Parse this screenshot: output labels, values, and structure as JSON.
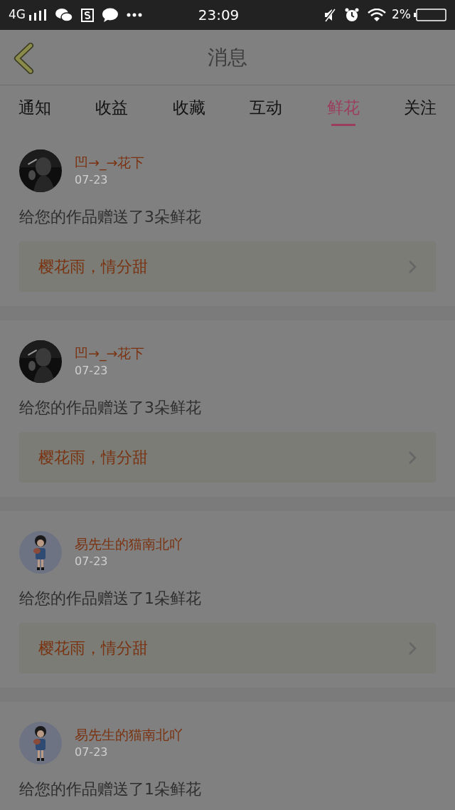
{
  "status_bar": {
    "network": "4G",
    "time": "23:09",
    "battery": "2%"
  },
  "header": {
    "title": "消息"
  },
  "tabs": [
    {
      "label": "通知",
      "selected": false
    },
    {
      "label": "收益",
      "selected": false
    },
    {
      "label": "收藏",
      "selected": false
    },
    {
      "label": "互动",
      "selected": false
    },
    {
      "label": "鲜花",
      "selected": true
    },
    {
      "label": "关注",
      "selected": false
    }
  ],
  "messages": [
    {
      "name": "凹→_→花下",
      "date": "07-23",
      "text": "给您的作品赠送了3朵鲜花",
      "link": "樱花雨，情分甜"
    },
    {
      "name": "凹→_→花下",
      "date": "07-23",
      "text": "给您的作品赠送了3朵鲜花",
      "link": "樱花雨，情分甜"
    },
    {
      "name": "易先生的猫南北吖",
      "date": "07-23",
      "text": "给您的作品赠送了1朵鲜花",
      "link": "樱花雨，情分甜"
    },
    {
      "name": "易先生的猫南北吖",
      "date": "07-23",
      "text": "给您的作品赠送了1朵鲜花"
    }
  ]
}
